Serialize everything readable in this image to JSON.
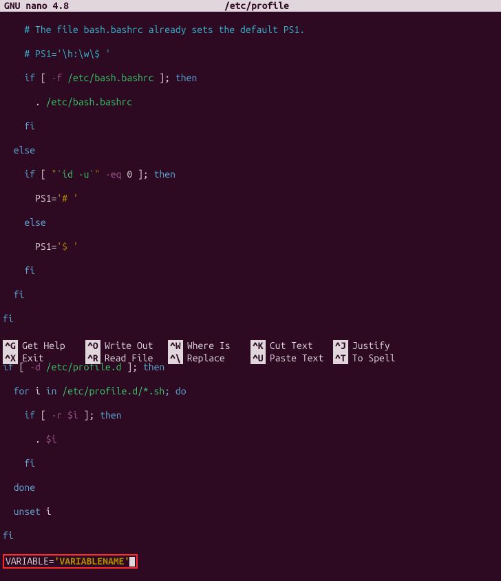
{
  "title": {
    "app": "GNU nano 4.8",
    "file": "/etc/profile"
  },
  "code": {
    "l1_cmt": "# The file bash.bashrc already sets the default PS1.",
    "l2_cmt_a": "# PS1=",
    "l2_str": "'\\h:\\w\\$ '",
    "l3_if": "if",
    "l3_b": " [ ",
    "l3_flag": "-f",
    "l3_path": " /etc/bash.bashrc",
    "l3_c": " ]; ",
    "l3_then": "then",
    "l4_dot": ". ",
    "l4_path": "/etc/bash.bashrc",
    "l5_fi": "fi",
    "l6_else": "else",
    "l7_if": "if",
    "l7_b": " [ ",
    "l7_q1": "\"",
    "l7_cmd": "`id -u`",
    "l7_q2": "\"",
    "l7_flag": " -eq",
    "l7_zero": " 0",
    "l7_c": " ]; ",
    "l7_then": "then",
    "l8_a": "PS1=",
    "l8_str": "'# '",
    "l9_else": "else",
    "l10_a": "PS1=",
    "l10_str": "'$ '",
    "l11_fi": "fi",
    "l12_fi": "fi",
    "l13_fi": "fi",
    "l15_if": "if",
    "l15_b": " [ ",
    "l15_flag": "-d",
    "l15_path": " /etc/profile.d",
    "l15_c": " ]; ",
    "l15_then": "then",
    "l16_for": "for",
    "l16_i": " i ",
    "l16_in": "in",
    "l16_path": " /etc/profile.d/*.sh",
    "l16_do": "; do",
    "l17_if": "if",
    "l17_b": " [ ",
    "l17_flag": "-r",
    "l17_var": " $i",
    "l17_c": " ]; ",
    "l17_then": "then",
    "l18_dot": ". ",
    "l18_var": "$i",
    "l19_fi": "fi",
    "l20_done": "done",
    "l21_unset": "unset",
    "l21_i": " i",
    "l22_fi": "fi",
    "var_line_a": "VARIABLE=",
    "var_line_b": "'VARIABLENAME'"
  },
  "shortcuts": {
    "row1": [
      {
        "key": "^G",
        "label": "Get Help"
      },
      {
        "key": "^O",
        "label": "Write Out"
      },
      {
        "key": "^W",
        "label": "Where Is"
      },
      {
        "key": "^K",
        "label": "Cut Text"
      },
      {
        "key": "^J",
        "label": "Justify"
      }
    ],
    "row2": [
      {
        "key": "^X",
        "label": "Exit"
      },
      {
        "key": "^R",
        "label": "Read File"
      },
      {
        "key": "^\\",
        "label": "Replace"
      },
      {
        "key": "^U",
        "label": "Paste Text"
      },
      {
        "key": "^T",
        "label": "To Spell"
      }
    ]
  }
}
